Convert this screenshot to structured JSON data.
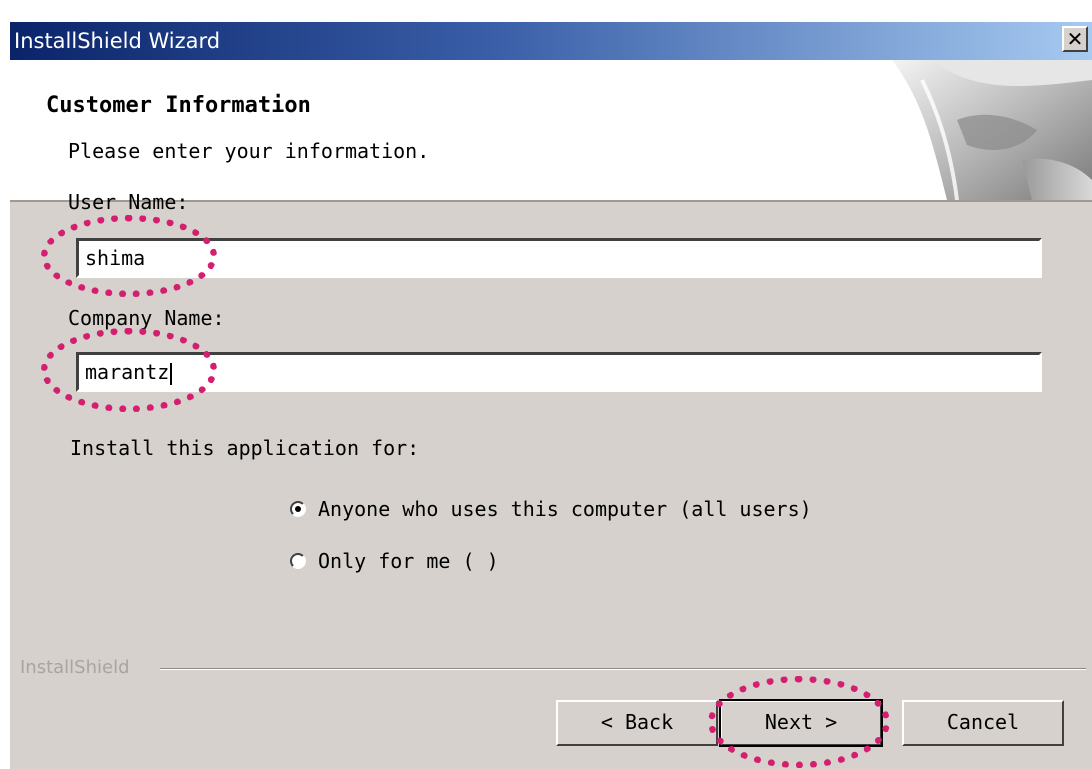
{
  "window": {
    "title": "InstallShield Wizard",
    "close_glyph": "✕"
  },
  "header": {
    "title": "Customer Information",
    "subtitle": "Please enter your information."
  },
  "form": {
    "user_name_label": "User Name:",
    "user_name_value": "shima",
    "company_name_label": "Company Name:",
    "company_name_value": "marantz",
    "install_for_label": "Install this application for:",
    "options": [
      {
        "label": "Anyone who uses this computer (all users)",
        "checked": true
      },
      {
        "label": "Only for me ( )",
        "checked": false
      }
    ]
  },
  "footer": {
    "brand": "InstallShield",
    "back_label": "< Back",
    "next_label": "Next >",
    "cancel_label": "Cancel"
  },
  "colors": {
    "highlight": "#d41f70",
    "dialog_bg": "#d6d1cc",
    "title_bar": "#0a246a"
  }
}
